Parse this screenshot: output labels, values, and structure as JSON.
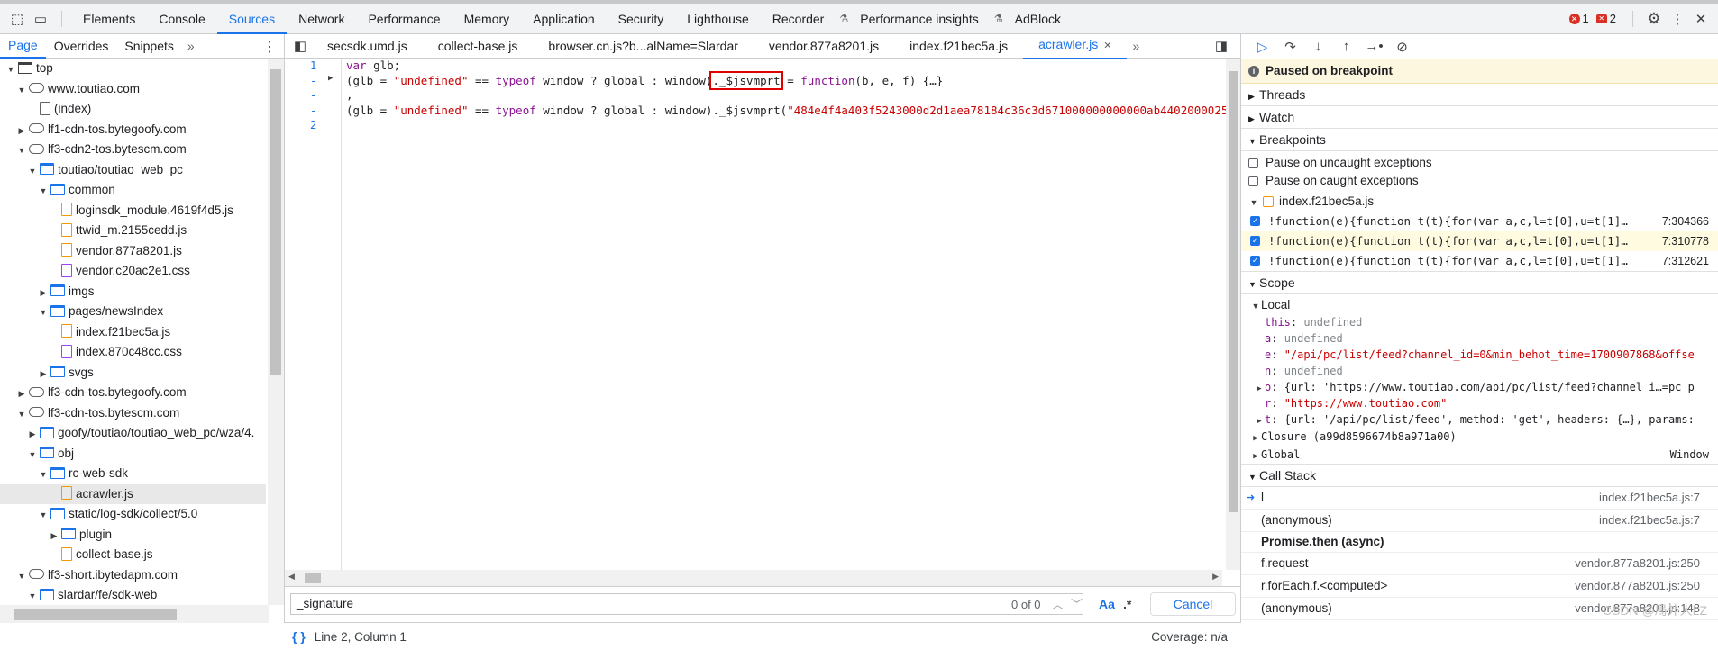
{
  "main_tabs": [
    "Elements",
    "Console",
    "Sources",
    "Network",
    "Performance",
    "Memory",
    "Application",
    "Security",
    "Lighthouse",
    "Recorder",
    "Performance insights",
    "AdBlock"
  ],
  "errors": {
    "error_count": "1",
    "warning_count": "2"
  },
  "left": {
    "subtabs": [
      "Page",
      "Overrides",
      "Snippets"
    ],
    "tree": [
      {
        "label": "top",
        "indent": 0,
        "icon": "frame",
        "tri": "▼"
      },
      {
        "label": "www.toutiao.com",
        "indent": 1,
        "icon": "cloud",
        "tri": "▼"
      },
      {
        "label": "(index)",
        "indent": 2,
        "icon": "doc",
        "tri": ""
      },
      {
        "label": "lf1-cdn-tos.bytegoofy.com",
        "indent": 1,
        "icon": "cloud",
        "tri": "▶"
      },
      {
        "label": "lf3-cdn2-tos.bytescm.com",
        "indent": 1,
        "icon": "cloud",
        "tri": "▼"
      },
      {
        "label": "toutiao/toutiao_web_pc",
        "indent": 2,
        "icon": "folder",
        "tri": "▼"
      },
      {
        "label": "common",
        "indent": 3,
        "icon": "folder",
        "tri": "▼"
      },
      {
        "label": "loginsdk_module.4619f4d5.js",
        "indent": 4,
        "icon": "js",
        "tri": ""
      },
      {
        "label": "ttwid_m.2155cedd.js",
        "indent": 4,
        "icon": "js",
        "tri": ""
      },
      {
        "label": "vendor.877a8201.js",
        "indent": 4,
        "icon": "js",
        "tri": ""
      },
      {
        "label": "vendor.c20ac2e1.css",
        "indent": 4,
        "icon": "css",
        "tri": ""
      },
      {
        "label": "imgs",
        "indent": 3,
        "icon": "folder",
        "tri": "▶"
      },
      {
        "label": "pages/newsIndex",
        "indent": 3,
        "icon": "folder",
        "tri": "▼"
      },
      {
        "label": "index.f21bec5a.js",
        "indent": 4,
        "icon": "js",
        "tri": ""
      },
      {
        "label": "index.870c48cc.css",
        "indent": 4,
        "icon": "css",
        "tri": ""
      },
      {
        "label": "svgs",
        "indent": 3,
        "icon": "folder",
        "tri": "▶"
      },
      {
        "label": "lf3-cdn-tos.bytegoofy.com",
        "indent": 1,
        "icon": "cloud",
        "tri": "▶"
      },
      {
        "label": "lf3-cdn-tos.bytescm.com",
        "indent": 1,
        "icon": "cloud",
        "tri": "▼"
      },
      {
        "label": "goofy/toutiao/toutiao_web_pc/wza/4.",
        "indent": 2,
        "icon": "folder",
        "tri": "▶"
      },
      {
        "label": "obj",
        "indent": 2,
        "icon": "folder",
        "tri": "▼"
      },
      {
        "label": "rc-web-sdk",
        "indent": 3,
        "icon": "folder",
        "tri": "▼"
      },
      {
        "label": "acrawler.js",
        "indent": 4,
        "icon": "js",
        "tri": "",
        "selected": true
      },
      {
        "label": "static/log-sdk/collect/5.0",
        "indent": 3,
        "icon": "folder",
        "tri": "▼"
      },
      {
        "label": "plugin",
        "indent": 4,
        "icon": "folder",
        "tri": "▶"
      },
      {
        "label": "collect-base.js",
        "indent": 4,
        "icon": "js",
        "tri": ""
      },
      {
        "label": "lf3-short.ibytedapm.com",
        "indent": 1,
        "icon": "cloud",
        "tri": "▼"
      },
      {
        "label": "slardar/fe/sdk-web",
        "indent": 2,
        "icon": "folder",
        "tri": "▼"
      }
    ]
  },
  "editor": {
    "tabs": [
      "secsdk.umd.js",
      "collect-base.js",
      "browser.cn.js?b...alName=Slardar",
      "vendor.877a8201.js",
      "index.f21bec5a.js",
      "acrawler.js"
    ],
    "active_tab_index": 5,
    "line_numbers": [
      "1",
      "-",
      "-",
      "-",
      "2"
    ],
    "code": {
      "l1_kw": "var",
      "l1_rest": " glb;",
      "l2_a": "(glb = ",
      "l2_s1": "\"undefined\"",
      "l2_b": " == ",
      "l2_kw": "typeof",
      "l2_c": " window ? global : window)",
      "l2_hl": "._$jsvmprt",
      "l2_d": " = ",
      "l2_fn": "function",
      "l2_e": "(b, e, f) {…}",
      "l3": ",",
      "l4_a": "(glb = ",
      "l4_s1": "\"undefined\"",
      "l4_b": " == ",
      "l4_kw": "typeof",
      "l4_c": " window ? global : window)._$jsvmprt(",
      "l4_s2": "\"484e4f4a403f5243000d2d1aea78184c36c3d671000000000000ab4402000025"
    },
    "search": {
      "value": "_signature",
      "count": "0 of 0",
      "cancel": "Cancel",
      "case_label": "Aa",
      "regex_label": ".*"
    },
    "status": {
      "position": "Line 2, Column 1",
      "coverage": "Coverage: n/a"
    }
  },
  "right": {
    "paused": "Paused on breakpoint",
    "sections": {
      "threads": "Threads",
      "watch": "Watch",
      "breakpoints": "Breakpoints",
      "scope": "Scope",
      "callstack": "Call Stack"
    },
    "pause_uncaught": "Pause on uncaught exceptions",
    "pause_caught": "Pause on caught exceptions",
    "bp_file": "index.f21bec5a.js",
    "breakpoints": [
      {
        "code": "!function(e){function t(t){for(var a,c,l=t[0],u=t[1]…",
        "loc": "7:304366",
        "current": false
      },
      {
        "code": "!function(e){function t(t){for(var a,c,l=t[0],u=t[1]…",
        "loc": "7:310778",
        "current": true
      },
      {
        "code": "!function(e){function t(t){for(var a,c,l=t[0],u=t[1]…",
        "loc": "7:312621",
        "current": false
      }
    ],
    "scope_local": "Local",
    "scope": [
      {
        "k": "this",
        "v": "undefined",
        "type": "u",
        "tri": ""
      },
      {
        "k": "a",
        "v": "undefined",
        "type": "u",
        "tri": ""
      },
      {
        "k": "e",
        "v": "\"/api/pc/list/feed?channel_id=0&min_behot_time=1700907868&offse",
        "type": "s",
        "tri": ""
      },
      {
        "k": "n",
        "v": "undefined",
        "type": "u",
        "tri": ""
      },
      {
        "k": "o",
        "v": "{url: 'https://www.toutiao.com/api/pc/list/feed?channel_i…=pc_p",
        "type": "o",
        "tri": "▶"
      },
      {
        "k": "r",
        "v": "\"https://www.toutiao.com\"",
        "type": "s",
        "tri": ""
      },
      {
        "k": "t",
        "v": "{url: '/api/pc/list/feed', method: 'get', headers: {…}, params:",
        "type": "o",
        "tri": "▶"
      }
    ],
    "closure": "Closure (a99d8596674b8a971a00)",
    "global": "Global",
    "global_val": "Window",
    "callstack": [
      {
        "fn": "l",
        "loc": "index.f21bec5a.js:7",
        "current": true
      },
      {
        "fn": "(anonymous)",
        "loc": "index.f21bec5a.js:7",
        "current": false
      },
      {
        "async": "Promise.then (async)"
      },
      {
        "fn": "f.request",
        "loc": "vendor.877a8201.js:250",
        "current": false
      },
      {
        "fn": "r.forEach.f.<computed>",
        "loc": "vendor.877a8201.js:250",
        "current": false
      },
      {
        "fn": "(anonymous)",
        "loc": "vendor.877a8201.js:148",
        "current": false
      }
    ],
    "watermark": "CSDN @局外人LZ"
  }
}
